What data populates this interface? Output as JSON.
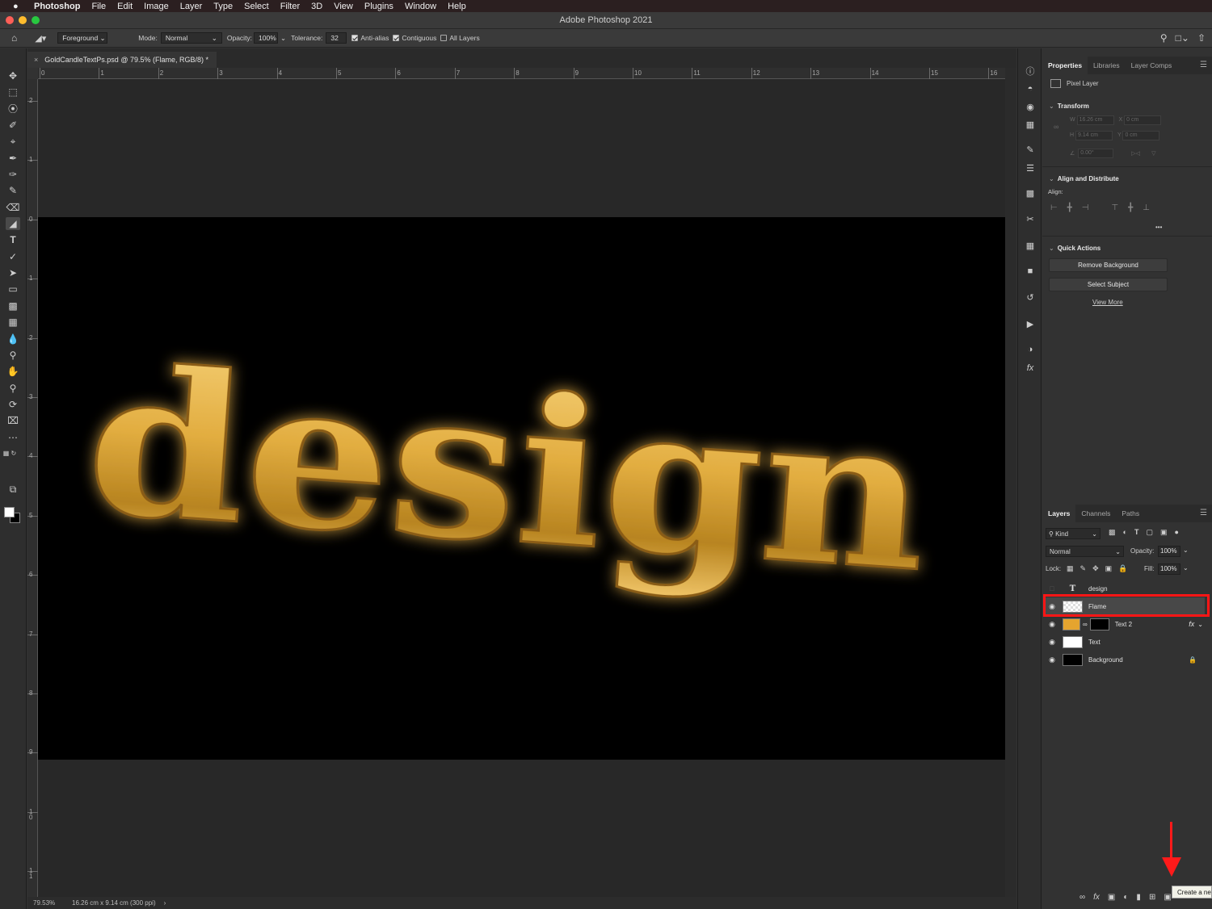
{
  "menubar": {
    "app": "Photoshop",
    "items": [
      "File",
      "Edit",
      "Image",
      "Layer",
      "Type",
      "Select",
      "Filter",
      "3D",
      "View",
      "Plugins",
      "Window",
      "Help"
    ]
  },
  "window": {
    "title": "Adobe Photoshop 2021"
  },
  "options": {
    "fill_source": "Foreground",
    "mode_label": "Mode:",
    "mode_value": "Normal",
    "opacity_label": "Opacity:",
    "opacity_value": "100%",
    "tolerance_label": "Tolerance:",
    "tolerance_value": "32",
    "anti_alias": "Anti-alias",
    "contiguous": "Contiguous",
    "all_layers": "All Layers"
  },
  "document": {
    "tab_title": "GoldCandleTextPs.psd @ 79.5% (Flame, RGB/8) *",
    "artwork_text": "design",
    "ruler_h": [
      "0",
      "1",
      "2",
      "3",
      "4",
      "5",
      "6",
      "7",
      "8",
      "9",
      "10",
      "11",
      "12",
      "13",
      "14",
      "15",
      "16"
    ],
    "ruler_v": [
      "2",
      "1",
      "0",
      "1",
      "2",
      "3",
      "4",
      "5",
      "6",
      "7",
      "8",
      "9",
      "1\n0",
      "1\n1"
    ]
  },
  "status": {
    "zoom": "79.53%",
    "size": "16.26 cm x 9.14 cm (300 ppi)",
    "arrow": "›"
  },
  "properties": {
    "tabs": [
      "Properties",
      "Libraries",
      "Layer Comps"
    ],
    "layer_type": "Pixel Layer",
    "transform_title": "Transform",
    "w_label": "W",
    "w_value": "16.26 cm",
    "x_label": "X",
    "x_value": "0 cm",
    "h_label": "H",
    "h_value": "9.14 cm",
    "y_label": "Y",
    "y_value": "0 cm",
    "angle_value": "0.00°",
    "align_title": "Align and Distribute",
    "align_label": "Align:",
    "more": "•••",
    "quick_title": "Quick Actions",
    "remove_bg": "Remove Background",
    "select_subject": "Select Subject",
    "view_more": "View More"
  },
  "layers_panel": {
    "tabs": [
      "Layers",
      "Channels",
      "Paths"
    ],
    "filter_kind": "Kind",
    "blend_mode": "Normal",
    "opacity_label": "Opacity:",
    "opacity_value": "100%",
    "lock_label": "Lock:",
    "fill_label": "Fill:",
    "fill_value": "100%",
    "layers": [
      {
        "name": "design",
        "type": "T"
      },
      {
        "name": "Flame"
      },
      {
        "name": "Text 2",
        "fx": "fx"
      },
      {
        "name": "Text"
      },
      {
        "name": "Background"
      }
    ],
    "tooltip": "Create a new layer"
  },
  "colors": {
    "accent_highlight": "#ff1616",
    "gold": "#e2ad40",
    "canvas": "#000000"
  }
}
